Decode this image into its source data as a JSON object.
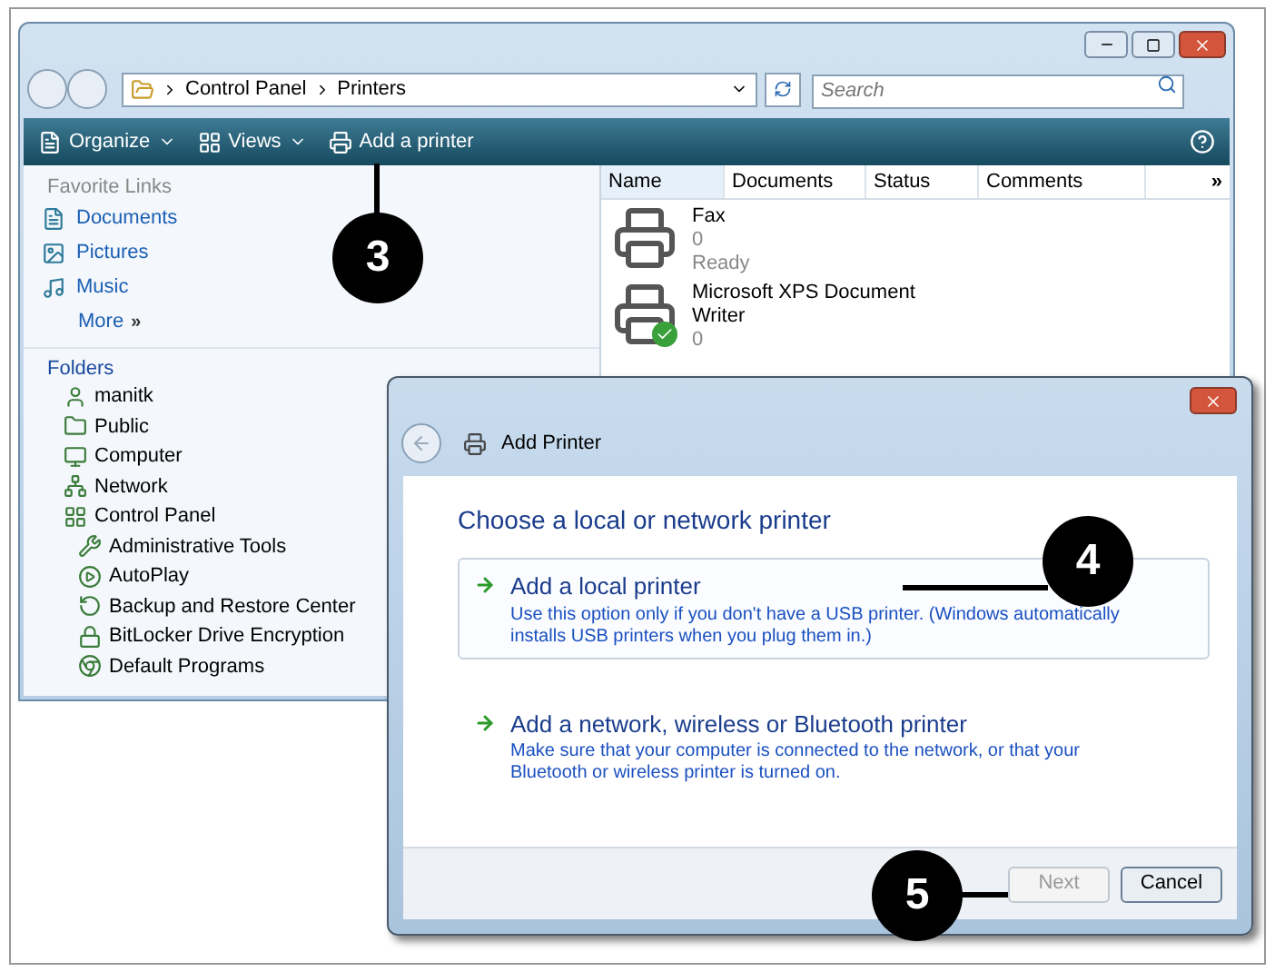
{
  "explorer": {
    "address": [
      "Control Panel",
      "Printers"
    ],
    "search": {
      "placeholder": "Search"
    },
    "toolbar": [
      {
        "label": "Organize",
        "kind": "menu"
      },
      {
        "label": "Views",
        "kind": "menu"
      },
      {
        "label": "Add a printer",
        "kind": "action"
      }
    ],
    "favorite_links": {
      "title": "Favorite Links",
      "items": [
        {
          "label": "Documents",
          "kind": "link"
        },
        {
          "label": "Pictures",
          "kind": "link"
        },
        {
          "label": "Music",
          "kind": "link"
        },
        {
          "label": "More",
          "kind": "more",
          "suffix": "»"
        }
      ]
    },
    "folders": {
      "title": "Folders",
      "items": [
        {
          "label": "manitk"
        },
        {
          "label": "Public"
        },
        {
          "label": "Computer"
        },
        {
          "label": "Network"
        },
        {
          "label": "Control Panel",
          "children": [
            {
              "label": "Administrative Tools"
            },
            {
              "label": "AutoPlay"
            },
            {
              "label": "Backup and Restore Center"
            },
            {
              "label": "BitLocker Drive Encryption"
            },
            {
              "label": "Default Programs"
            }
          ]
        }
      ]
    },
    "columns": [
      "Name",
      "Documents",
      "Status",
      "Comments",
      "»"
    ],
    "printers": [
      {
        "name": "Fax",
        "documents": "0",
        "status": "Ready",
        "default": false
      },
      {
        "name": "Microsoft XPS Document Writer",
        "documents": "0",
        "default": true
      }
    ]
  },
  "dialog": {
    "title": "Add Printer",
    "heading": "Choose a local or network printer",
    "options": [
      {
        "title": "Add a local printer",
        "description": "Use this option only if you don't have a USB printer. (Windows automatically installs USB printers when you plug them in.)",
        "selected": true
      },
      {
        "title": "Add a network, wireless or Bluetooth printer",
        "description": "Make sure that your computer is connected to the network, or that your Bluetooth or wireless printer is turned on.",
        "selected": false
      }
    ],
    "buttons": [
      {
        "label": "Next",
        "disabled": true
      },
      {
        "label": "Cancel",
        "disabled": false
      }
    ]
  },
  "callouts": [
    "3",
    "4",
    "5"
  ]
}
